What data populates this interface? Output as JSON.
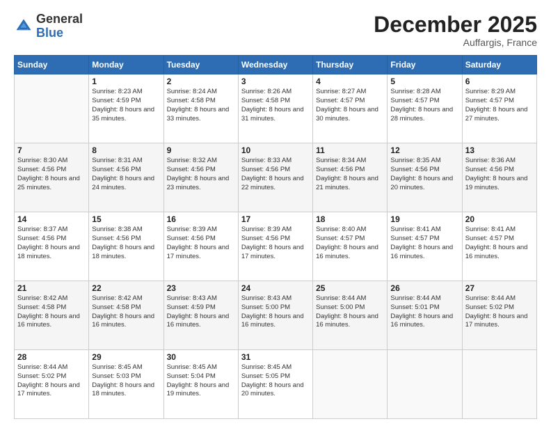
{
  "logo": {
    "general": "General",
    "blue": "Blue"
  },
  "header": {
    "month": "December 2025",
    "location": "Auffargis, France"
  },
  "weekdays": [
    "Sunday",
    "Monday",
    "Tuesday",
    "Wednesday",
    "Thursday",
    "Friday",
    "Saturday"
  ],
  "weeks": [
    [
      {
        "day": "",
        "sunrise": "",
        "sunset": "",
        "daylight": "",
        "empty": true
      },
      {
        "day": "1",
        "sunrise": "Sunrise: 8:23 AM",
        "sunset": "Sunset: 4:59 PM",
        "daylight": "Daylight: 8 hours and 35 minutes."
      },
      {
        "day": "2",
        "sunrise": "Sunrise: 8:24 AM",
        "sunset": "Sunset: 4:58 PM",
        "daylight": "Daylight: 8 hours and 33 minutes."
      },
      {
        "day": "3",
        "sunrise": "Sunrise: 8:26 AM",
        "sunset": "Sunset: 4:58 PM",
        "daylight": "Daylight: 8 hours and 31 minutes."
      },
      {
        "day": "4",
        "sunrise": "Sunrise: 8:27 AM",
        "sunset": "Sunset: 4:57 PM",
        "daylight": "Daylight: 8 hours and 30 minutes."
      },
      {
        "day": "5",
        "sunrise": "Sunrise: 8:28 AM",
        "sunset": "Sunset: 4:57 PM",
        "daylight": "Daylight: 8 hours and 28 minutes."
      },
      {
        "day": "6",
        "sunrise": "Sunrise: 8:29 AM",
        "sunset": "Sunset: 4:57 PM",
        "daylight": "Daylight: 8 hours and 27 minutes."
      }
    ],
    [
      {
        "day": "7",
        "sunrise": "Sunrise: 8:30 AM",
        "sunset": "Sunset: 4:56 PM",
        "daylight": "Daylight: 8 hours and 25 minutes."
      },
      {
        "day": "8",
        "sunrise": "Sunrise: 8:31 AM",
        "sunset": "Sunset: 4:56 PM",
        "daylight": "Daylight: 8 hours and 24 minutes."
      },
      {
        "day": "9",
        "sunrise": "Sunrise: 8:32 AM",
        "sunset": "Sunset: 4:56 PM",
        "daylight": "Daylight: 8 hours and 23 minutes."
      },
      {
        "day": "10",
        "sunrise": "Sunrise: 8:33 AM",
        "sunset": "Sunset: 4:56 PM",
        "daylight": "Daylight: 8 hours and 22 minutes."
      },
      {
        "day": "11",
        "sunrise": "Sunrise: 8:34 AM",
        "sunset": "Sunset: 4:56 PM",
        "daylight": "Daylight: 8 hours and 21 minutes."
      },
      {
        "day": "12",
        "sunrise": "Sunrise: 8:35 AM",
        "sunset": "Sunset: 4:56 PM",
        "daylight": "Daylight: 8 hours and 20 minutes."
      },
      {
        "day": "13",
        "sunrise": "Sunrise: 8:36 AM",
        "sunset": "Sunset: 4:56 PM",
        "daylight": "Daylight: 8 hours and 19 minutes."
      }
    ],
    [
      {
        "day": "14",
        "sunrise": "Sunrise: 8:37 AM",
        "sunset": "Sunset: 4:56 PM",
        "daylight": "Daylight: 8 hours and 18 minutes."
      },
      {
        "day": "15",
        "sunrise": "Sunrise: 8:38 AM",
        "sunset": "Sunset: 4:56 PM",
        "daylight": "Daylight: 8 hours and 18 minutes."
      },
      {
        "day": "16",
        "sunrise": "Sunrise: 8:39 AM",
        "sunset": "Sunset: 4:56 PM",
        "daylight": "Daylight: 8 hours and 17 minutes."
      },
      {
        "day": "17",
        "sunrise": "Sunrise: 8:39 AM",
        "sunset": "Sunset: 4:56 PM",
        "daylight": "Daylight: 8 hours and 17 minutes."
      },
      {
        "day": "18",
        "sunrise": "Sunrise: 8:40 AM",
        "sunset": "Sunset: 4:57 PM",
        "daylight": "Daylight: 8 hours and 16 minutes."
      },
      {
        "day": "19",
        "sunrise": "Sunrise: 8:41 AM",
        "sunset": "Sunset: 4:57 PM",
        "daylight": "Daylight: 8 hours and 16 minutes."
      },
      {
        "day": "20",
        "sunrise": "Sunrise: 8:41 AM",
        "sunset": "Sunset: 4:57 PM",
        "daylight": "Daylight: 8 hours and 16 minutes."
      }
    ],
    [
      {
        "day": "21",
        "sunrise": "Sunrise: 8:42 AM",
        "sunset": "Sunset: 4:58 PM",
        "daylight": "Daylight: 8 hours and 16 minutes."
      },
      {
        "day": "22",
        "sunrise": "Sunrise: 8:42 AM",
        "sunset": "Sunset: 4:58 PM",
        "daylight": "Daylight: 8 hours and 16 minutes."
      },
      {
        "day": "23",
        "sunrise": "Sunrise: 8:43 AM",
        "sunset": "Sunset: 4:59 PM",
        "daylight": "Daylight: 8 hours and 16 minutes."
      },
      {
        "day": "24",
        "sunrise": "Sunrise: 8:43 AM",
        "sunset": "Sunset: 5:00 PM",
        "daylight": "Daylight: 8 hours and 16 minutes."
      },
      {
        "day": "25",
        "sunrise": "Sunrise: 8:44 AM",
        "sunset": "Sunset: 5:00 PM",
        "daylight": "Daylight: 8 hours and 16 minutes."
      },
      {
        "day": "26",
        "sunrise": "Sunrise: 8:44 AM",
        "sunset": "Sunset: 5:01 PM",
        "daylight": "Daylight: 8 hours and 16 minutes."
      },
      {
        "day": "27",
        "sunrise": "Sunrise: 8:44 AM",
        "sunset": "Sunset: 5:02 PM",
        "daylight": "Daylight: 8 hours and 17 minutes."
      }
    ],
    [
      {
        "day": "28",
        "sunrise": "Sunrise: 8:44 AM",
        "sunset": "Sunset: 5:02 PM",
        "daylight": "Daylight: 8 hours and 17 minutes."
      },
      {
        "day": "29",
        "sunrise": "Sunrise: 8:45 AM",
        "sunset": "Sunset: 5:03 PM",
        "daylight": "Daylight: 8 hours and 18 minutes."
      },
      {
        "day": "30",
        "sunrise": "Sunrise: 8:45 AM",
        "sunset": "Sunset: 5:04 PM",
        "daylight": "Daylight: 8 hours and 19 minutes."
      },
      {
        "day": "31",
        "sunrise": "Sunrise: 8:45 AM",
        "sunset": "Sunset: 5:05 PM",
        "daylight": "Daylight: 8 hours and 20 minutes."
      },
      {
        "day": "",
        "empty": true
      },
      {
        "day": "",
        "empty": true
      },
      {
        "day": "",
        "empty": true
      }
    ]
  ]
}
